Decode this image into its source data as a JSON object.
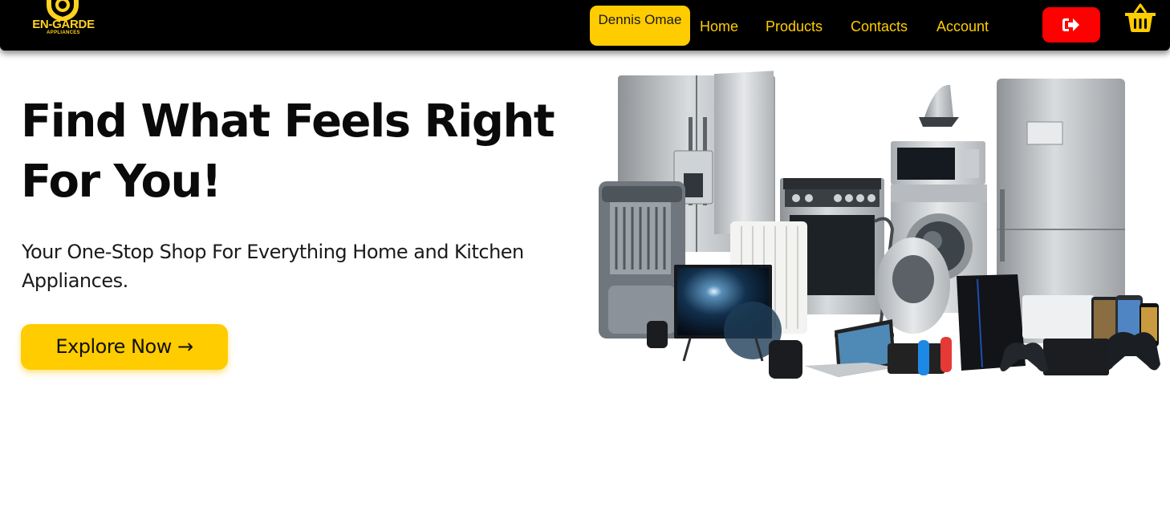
{
  "brand": {
    "name": "EN-GARDE",
    "tagline": "APPLIANCES",
    "color": "#ffd21f"
  },
  "navbar": {
    "user_name": "Dennis Omae",
    "links": [
      {
        "label": "Home"
      },
      {
        "label": "Products"
      },
      {
        "label": "Contacts"
      },
      {
        "label": "Account"
      }
    ],
    "logout_icon": "sign-out-icon",
    "cart_icon": "shopping-basket-icon"
  },
  "hero": {
    "title": "Find What Feels Right For You!",
    "subtitle": "Your One-Stop Shop For Everything Home and Kitchen Appliances.",
    "cta_label": "Explore Now →",
    "image": "home-appliances-collection"
  },
  "colors": {
    "accent": "#ffcc00",
    "nav_background": "#000000",
    "logout": "#ff0000"
  }
}
